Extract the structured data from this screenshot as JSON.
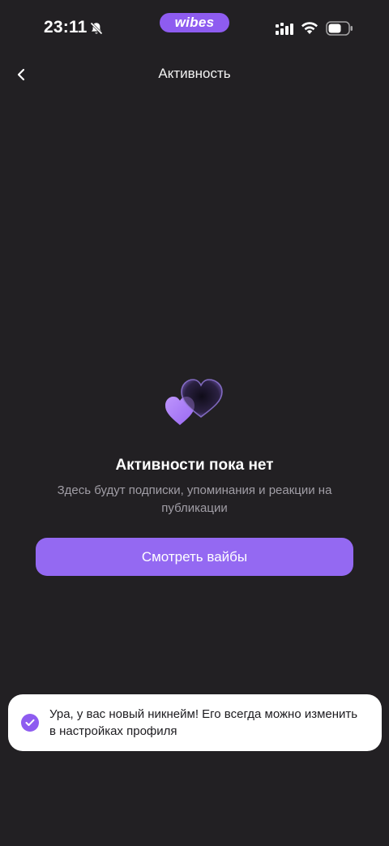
{
  "status_bar": {
    "time": "23:11",
    "brand": "wibes",
    "icons": [
      "bell-slash-icon",
      "cellular-signal-icon",
      "wifi-icon",
      "battery-icon"
    ]
  },
  "nav": {
    "back_icon": "chevron-left-icon",
    "title": "Активность"
  },
  "empty_state": {
    "illustration": "hearts-icon",
    "title": "Активности пока нет",
    "subtitle": "Здесь будут подписки, упоминания и реакции на публикации",
    "button_label": "Смотреть вайбы"
  },
  "toast": {
    "icon": "check-circle-icon",
    "message": "Ура, у вас новый никнейм! Его всегда можно изменить в настройках профиля"
  },
  "colors": {
    "background": "#222023",
    "accent": "#9469f2",
    "subtitle_text": "#a19ea6",
    "toast_background": "#ffffff"
  }
}
